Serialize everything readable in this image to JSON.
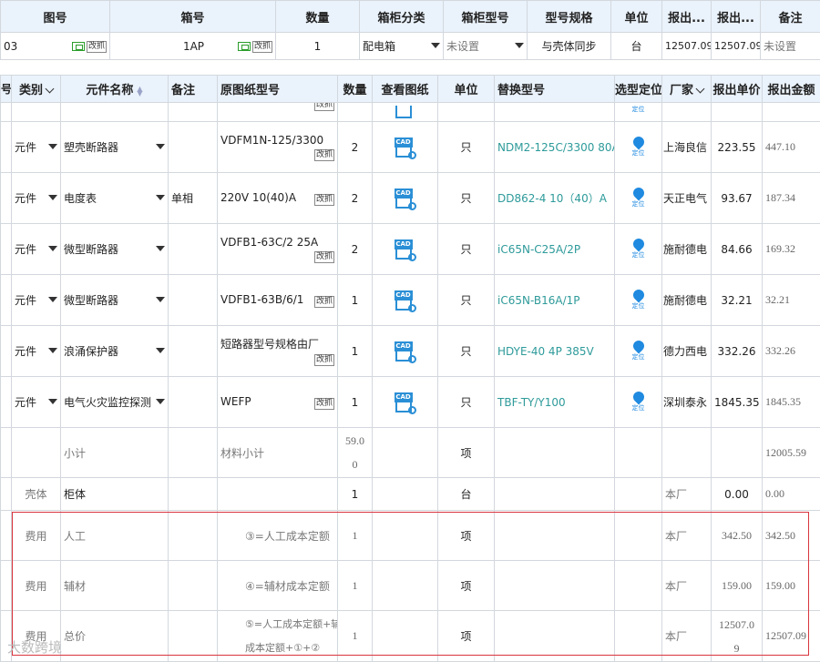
{
  "cabinet_table": {
    "headers": [
      "图号",
      "箱号",
      "数量",
      "箱柜分类",
      "箱柜型号",
      "型号规格",
      "单位",
      "报出...",
      "报出...",
      "备注"
    ],
    "row": {
      "drawing_no": "03",
      "query_label": "改抓",
      "box_no": "1AP",
      "qty": "1",
      "category": "配电箱",
      "model_placeholder": "未设置",
      "spec": "与壳体同步",
      "unit": "台",
      "price1": "12507.09",
      "price2": "12507.09",
      "remark_placeholder": "未设置"
    }
  },
  "component_table": {
    "headers": {
      "col0": "号",
      "category": "类别",
      "name": "元件名称",
      "remark": "备注",
      "orig_model": "原图纸型号",
      "qty": "数量",
      "view": "查看图纸",
      "unit": "单位",
      "replace": "替换型号",
      "locate": "选型定位",
      "vendor": "厂家",
      "unit_price": "报出单价",
      "amount": "报出金额"
    },
    "cad_label": "CAD",
    "locate_label": "定位",
    "edit_label": "改抓",
    "rows": [
      {
        "category": "元件",
        "name": "塑壳断路器",
        "remark": "",
        "model": "VDFM1N-125/3300",
        "qty": "2",
        "unit": "只",
        "replace": "NDM2-125C/3300 80A",
        "vendor": "上海良信",
        "price": "223.55",
        "amount": "447.10"
      },
      {
        "category": "元件",
        "name": "电度表",
        "remark": "单相",
        "model": "220V 10(40)A",
        "qty": "2",
        "unit": "只",
        "replace": "DD862-4 10（40）A",
        "vendor": "天正电气",
        "price": "93.67",
        "amount": "187.34"
      },
      {
        "category": "元件",
        "name": "微型断路器",
        "remark": "",
        "model": "VDFB1-63C/2 25A",
        "qty": "2",
        "unit": "只",
        "replace": "iC65N-C25A/2P",
        "vendor": "施耐德电",
        "price": "84.66",
        "amount": "169.32"
      },
      {
        "category": "元件",
        "name": "微型断路器",
        "remark": "",
        "model": "VDFB1-63B/6/1",
        "qty": "1",
        "unit": "只",
        "replace": "iC65N-B16A/1P",
        "vendor": "施耐德电",
        "price": "32.21",
        "amount": "32.21"
      },
      {
        "category": "元件",
        "name": "浪涌保护器",
        "remark": "",
        "model": "短路器型号规格由厂",
        "qty": "1",
        "unit": "只",
        "replace": "HDYE-40 4P 385V",
        "vendor": "德力西电",
        "price": "332.26",
        "amount": "332.26"
      },
      {
        "category": "元件",
        "name": "电气火灾监控探测",
        "remark": "",
        "model": "WEFP",
        "qty": "1",
        "unit": "只",
        "replace": "TBF-TY/Y100",
        "vendor": "深圳泰永",
        "price": "1845.35",
        "amount": "1845.35"
      }
    ],
    "subtotal": {
      "name": "小计",
      "model": "材料小计",
      "qty_a": "59.0",
      "qty_b": "0",
      "unit": "项",
      "amount": "12005.59"
    },
    "shell": {
      "category": "壳体",
      "name": "柜体",
      "qty": "1",
      "unit": "台",
      "vendor": "本厂",
      "price": "0.00",
      "amount": "0.00"
    },
    "fees": [
      {
        "category": "费用",
        "name": "人工",
        "model": "③=人工成本定额",
        "qty": "1",
        "unit": "项",
        "vendor": "本厂",
        "price": "342.50",
        "amount": "342.50"
      },
      {
        "category": "费用",
        "name": "辅材",
        "model": "④=辅材成本定额",
        "qty": "1",
        "unit": "项",
        "vendor": "本厂",
        "price": "159.00",
        "amount": "159.00"
      }
    ],
    "total": {
      "category": "费用",
      "name": "总价",
      "model_a": "⑤=人工成本定额+辅材",
      "model_b": "成本定额+①+②",
      "qty": "1",
      "unit": "项",
      "vendor": "本厂",
      "price_a": "12507.0",
      "price_b": "9",
      "amount": "12507.09"
    }
  },
  "watermark": "大数跨境"
}
